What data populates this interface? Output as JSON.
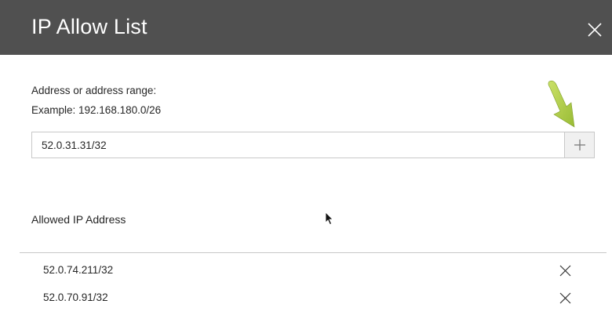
{
  "dialog": {
    "title": "IP Allow List"
  },
  "form": {
    "label": "Address or address range:",
    "example": "Example: 192.168.180.0/26",
    "input_value": "52.0.31.31/32"
  },
  "list": {
    "heading": "Allowed IP Address",
    "items": [
      {
        "ip": "52.0.74.211/32"
      },
      {
        "ip": "52.0.70.91/32"
      }
    ]
  },
  "icons": {
    "close": "close-icon",
    "add": "plus-icon",
    "remove": "close-icon",
    "annotation": "arrow-down-icon",
    "cursor": "mouse-pointer-icon"
  },
  "colors": {
    "header_bg": "#505050",
    "annotation_arrow": "#a4c639"
  }
}
